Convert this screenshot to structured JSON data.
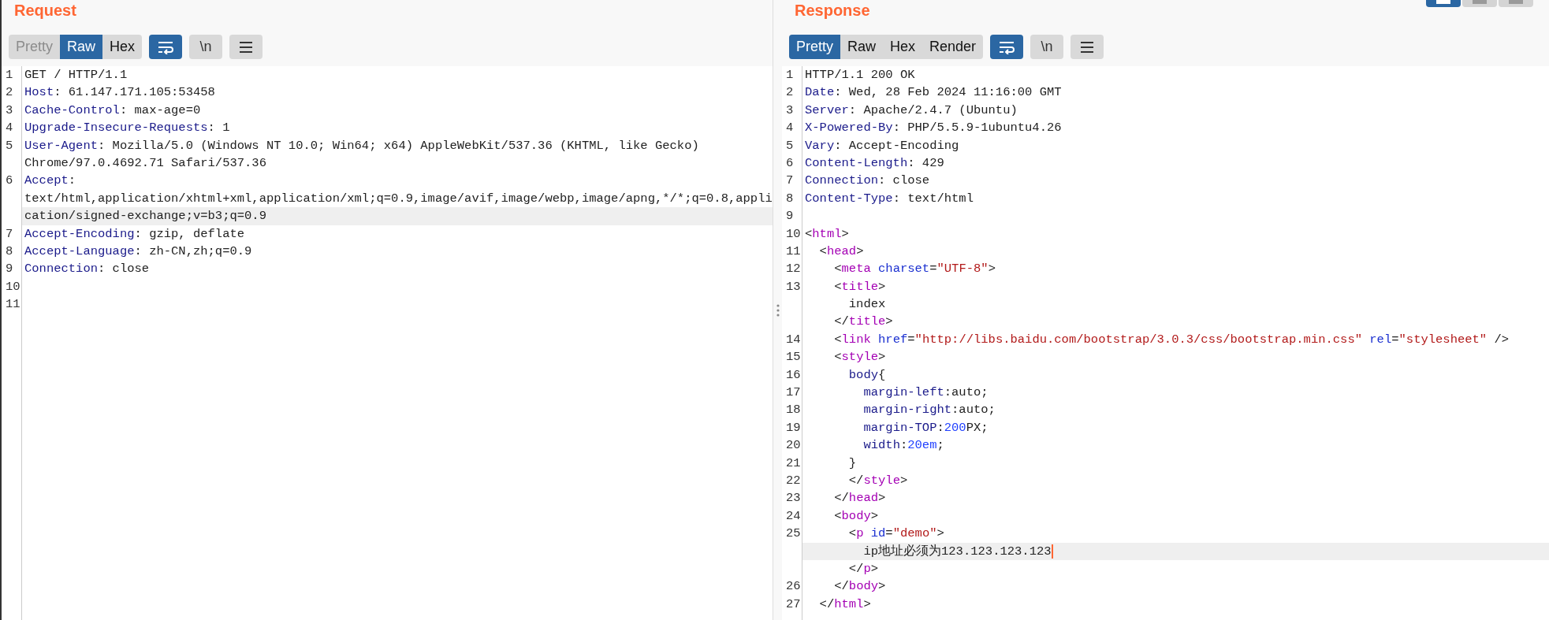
{
  "panels": [
    {
      "title": "Request",
      "tabs": [
        {
          "label": "Pretty",
          "selected": false,
          "disabled": true
        },
        {
          "label": "Raw",
          "selected": true,
          "disabled": false
        },
        {
          "label": "Hex",
          "selected": false,
          "disabled": false
        }
      ],
      "tools": [
        {
          "kind": "wrap",
          "active": true
        },
        {
          "kind": "newline",
          "label": "\\n",
          "active": false
        },
        {
          "kind": "menu",
          "active": false
        }
      ],
      "lines": [
        {
          "number": "1",
          "rows": [
            {
              "kind": "plain",
              "text": "GET / HTTP/1.1",
              "highlighted": false,
              "caret": false
            }
          ]
        },
        {
          "number": "2",
          "rows": [
            {
              "kind": "header",
              "text": "Host: 61.147.171.105:53458",
              "highlighted": false,
              "caret": false
            }
          ]
        },
        {
          "number": "3",
          "rows": [
            {
              "kind": "header",
              "text": "Cache-Control: max-age=0",
              "highlighted": false,
              "caret": false
            }
          ]
        },
        {
          "number": "4",
          "rows": [
            {
              "kind": "header",
              "text": "Upgrade-Insecure-Requests: 1",
              "highlighted": false,
              "caret": false
            }
          ]
        },
        {
          "number": "5",
          "rows": [
            {
              "kind": "header",
              "text": "User-Agent: Mozilla/5.0 (Windows NT 10.0; Win64; x64) AppleWebKit/537.36 (KHTML, like Gecko)",
              "highlighted": false,
              "caret": false
            },
            {
              "kind": "plain",
              "text": "Chrome/97.0.4692.71 Safari/537.36",
              "highlighted": false,
              "caret": false
            }
          ]
        },
        {
          "number": "6",
          "rows": [
            {
              "kind": "header",
              "text": "Accept:",
              "highlighted": false,
              "caret": false
            },
            {
              "kind": "plain",
              "text": "text/html,application/xhtml+xml,application/xml;q=0.9,image/avif,image/webp,image/apng,*/*;q=0.8,appli",
              "highlighted": false,
              "caret": false
            },
            {
              "kind": "plain",
              "text": "cation/signed-exchange;v=b3;q=0.9",
              "highlighted": true,
              "caret": false
            }
          ]
        },
        {
          "number": "7",
          "rows": [
            {
              "kind": "header",
              "text": "Accept-Encoding: gzip, deflate",
              "highlighted": false,
              "caret": false
            }
          ]
        },
        {
          "number": "8",
          "rows": [
            {
              "kind": "header",
              "text": "Accept-Language: zh-CN,zh;q=0.9",
              "highlighted": false,
              "caret": false
            }
          ]
        },
        {
          "number": "9",
          "rows": [
            {
              "kind": "header",
              "text": "Connection: close",
              "highlighted": false,
              "caret": false
            }
          ]
        },
        {
          "number": "10",
          "rows": [
            {
              "kind": "blank",
              "highlighted": false,
              "caret": false
            }
          ]
        },
        {
          "number": "11",
          "rows": [
            {
              "kind": "blank",
              "highlighted": false,
              "caret": false
            }
          ]
        }
      ]
    },
    {
      "title": "Response",
      "view_buttons": [
        {
          "selected": true
        },
        {
          "selected": false
        },
        {
          "selected": false
        }
      ],
      "tabs": [
        {
          "label": "Pretty",
          "selected": true,
          "disabled": false
        },
        {
          "label": "Raw",
          "selected": false,
          "disabled": false
        },
        {
          "label": "Hex",
          "selected": false,
          "disabled": false
        },
        {
          "label": "Render",
          "selected": false,
          "disabled": false
        }
      ],
      "tools": [
        {
          "kind": "wrap",
          "active": true
        },
        {
          "kind": "newline",
          "label": "\\n",
          "active": false
        },
        {
          "kind": "menu",
          "active": false
        }
      ],
      "lines": [
        {
          "number": "1",
          "rows": [
            {
              "kind": "plain",
              "text": "HTTP/1.1 200 OK",
              "highlighted": false,
              "caret": false
            }
          ]
        },
        {
          "number": "2",
          "rows": [
            {
              "kind": "header",
              "text": "Date: Wed, 28 Feb 2024 11:16:00 GMT",
              "highlighted": false,
              "caret": false
            }
          ]
        },
        {
          "number": "3",
          "rows": [
            {
              "kind": "header",
              "text": "Server: Apache/2.4.7 (Ubuntu)",
              "highlighted": false,
              "caret": false
            }
          ]
        },
        {
          "number": "4",
          "rows": [
            {
              "kind": "header",
              "text": "X-Powered-By: PHP/5.5.9-1ubuntu4.26",
              "highlighted": false,
              "caret": false
            }
          ]
        },
        {
          "number": "5",
          "rows": [
            {
              "kind": "header",
              "text": "Vary: Accept-Encoding",
              "highlighted": false,
              "caret": false
            }
          ]
        },
        {
          "number": "6",
          "rows": [
            {
              "kind": "header",
              "text": "Content-Length: 429",
              "highlighted": false,
              "caret": false
            }
          ]
        },
        {
          "number": "7",
          "rows": [
            {
              "kind": "header",
              "text": "Connection: close",
              "highlighted": false,
              "caret": false
            }
          ]
        },
        {
          "number": "8",
          "rows": [
            {
              "kind": "header",
              "text": "Content-Type: text/html",
              "highlighted": false,
              "caret": false
            }
          ]
        },
        {
          "number": "9",
          "rows": [
            {
              "kind": "blank",
              "highlighted": false,
              "caret": false
            }
          ]
        },
        {
          "number": "10",
          "rows": [
            {
              "kind": "html",
              "text": "<html>",
              "highlighted": false,
              "caret": false
            }
          ]
        },
        {
          "number": "11",
          "rows": [
            {
              "kind": "html",
              "text": "  <head>",
              "highlighted": false,
              "caret": false
            }
          ]
        },
        {
          "number": "12",
          "rows": [
            {
              "kind": "html",
              "text": "    <meta charset=\"UTF-8\">",
              "highlighted": false,
              "caret": false
            }
          ]
        },
        {
          "number": "13",
          "rows": [
            {
              "kind": "html",
              "text": "    <title>",
              "highlighted": false,
              "caret": false
            },
            {
              "kind": "plain",
              "text": "      index",
              "highlighted": false,
              "caret": false
            },
            {
              "kind": "html",
              "text": "    </title>",
              "highlighted": false,
              "caret": false
            }
          ]
        },
        {
          "number": "14",
          "rows": [
            {
              "kind": "html",
              "text": "    <link href=\"http://libs.baidu.com/bootstrap/3.0.3/css/bootstrap.min.css\" rel=\"stylesheet\" />",
              "highlighted": false,
              "caret": false
            }
          ]
        },
        {
          "number": "15",
          "rows": [
            {
              "kind": "html",
              "text": "    <style>",
              "highlighted": false,
              "caret": false
            }
          ]
        },
        {
          "number": "16",
          "rows": [
            {
              "kind": "css",
              "text": "      body{",
              "highlighted": false,
              "caret": false
            }
          ]
        },
        {
          "number": "17",
          "rows": [
            {
              "kind": "css",
              "text": "        margin-left:auto;",
              "highlighted": false,
              "caret": false
            }
          ]
        },
        {
          "number": "18",
          "rows": [
            {
              "kind": "css",
              "text": "        margin-right:auto;",
              "highlighted": false,
              "caret": false
            }
          ]
        },
        {
          "number": "19",
          "rows": [
            {
              "kind": "css",
              "text": "        margin-TOP:200PX;",
              "highlighted": false,
              "caret": false
            }
          ]
        },
        {
          "number": "20",
          "rows": [
            {
              "kind": "css",
              "text": "        width:20em;",
              "highlighted": false,
              "caret": false
            }
          ]
        },
        {
          "number": "21",
          "rows": [
            {
              "kind": "plain",
              "text": "      }",
              "highlighted": false,
              "caret": false
            }
          ]
        },
        {
          "number": "22",
          "rows": [
            {
              "kind": "html",
              "text": "      </style>",
              "highlighted": false,
              "caret": false
            }
          ]
        },
        {
          "number": "23",
          "rows": [
            {
              "kind": "html",
              "text": "    </head>",
              "highlighted": false,
              "caret": false
            }
          ]
        },
        {
          "number": "24",
          "rows": [
            {
              "kind": "html",
              "text": "    <body>",
              "highlighted": false,
              "caret": false
            }
          ]
        },
        {
          "number": "25",
          "rows": [
            {
              "kind": "html",
              "text": "      <p id=\"demo\">",
              "highlighted": false,
              "caret": false
            },
            {
              "kind": "plain",
              "text": "        ip地址必须为123.123.123.123",
              "highlighted": true,
              "caret": true
            },
            {
              "kind": "html",
              "text": "      </p>",
              "highlighted": false,
              "caret": false
            }
          ]
        },
        {
          "number": "26",
          "rows": [
            {
              "kind": "html",
              "text": "    </body>",
              "highlighted": false,
              "caret": false
            }
          ]
        },
        {
          "number": "27",
          "rows": [
            {
              "kind": "html",
              "text": "  </html>",
              "highlighted": false,
              "caret": false
            }
          ]
        }
      ]
    }
  ]
}
